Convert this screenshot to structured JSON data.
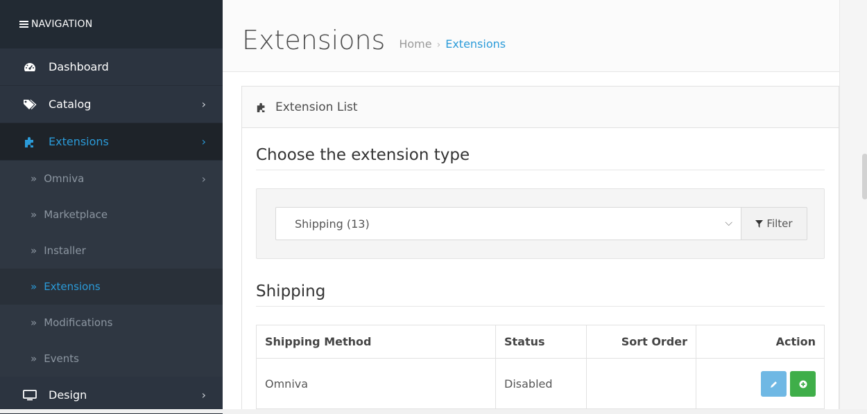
{
  "nav": {
    "header": "NAVIGATION",
    "items": [
      {
        "label": "Dashboard",
        "icon": "tachometer-icon"
      },
      {
        "label": "Catalog",
        "icon": "tags-icon"
      },
      {
        "label": "Extensions",
        "icon": "puzzle-icon",
        "active": true
      }
    ],
    "sub_items": [
      {
        "label": "Omniva"
      },
      {
        "label": "Marketplace"
      },
      {
        "label": "Installer"
      },
      {
        "label": "Extensions",
        "active": true
      },
      {
        "label": "Modifications"
      },
      {
        "label": "Events"
      }
    ],
    "design": {
      "label": "Design",
      "icon": "desktop-icon"
    }
  },
  "header": {
    "title": "Extensions",
    "breadcrumb": [
      "Home",
      "Extensions"
    ]
  },
  "panel": {
    "heading": "Extension List",
    "choose_title": "Choose the extension type",
    "select_value": "Shipping (13)",
    "filter_label": "Filter",
    "section_title": "Shipping"
  },
  "table": {
    "columns": [
      "Shipping Method",
      "Status",
      "Sort Order",
      "Action"
    ],
    "rows": [
      {
        "method": "Omniva",
        "status": "Disabled",
        "sort_order": ""
      }
    ]
  },
  "colors": {
    "accent": "#2b9bd9",
    "sidebar_bg": "#2c3440",
    "edit_button": "#6fb8e4",
    "install_button": "#3fae49"
  }
}
